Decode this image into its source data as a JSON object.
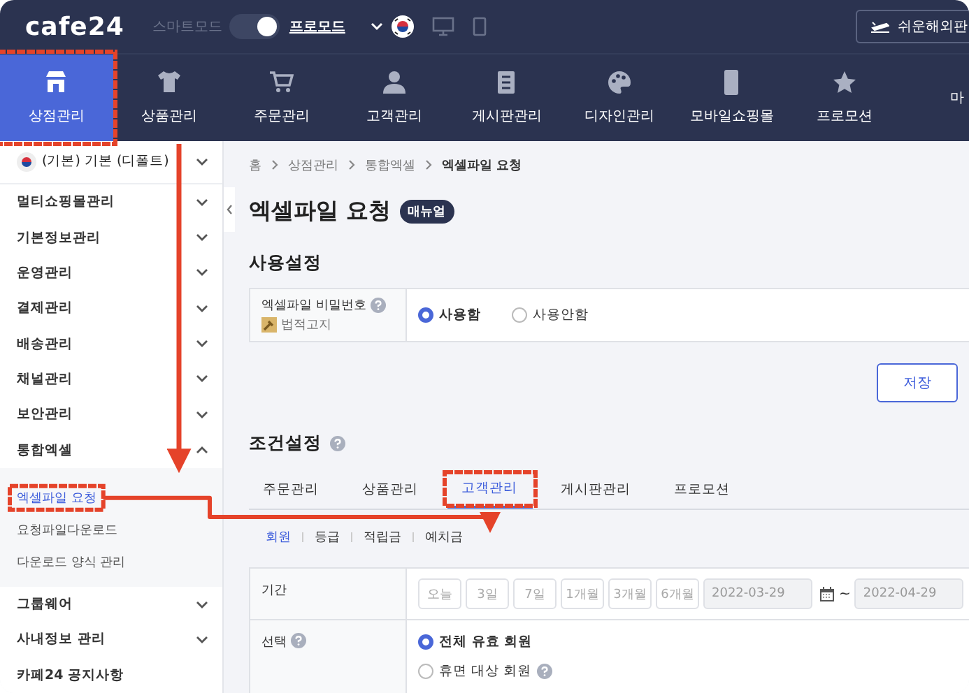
{
  "header": {
    "logo": "cafe24",
    "mode_label": "스마트모드",
    "mode_toggle": {
      "on": true
    },
    "pro_mode": "프로모드",
    "overseas_button": "쉬운해외판"
  },
  "nav": [
    {
      "label": "상점관리",
      "selected": true
    },
    {
      "label": "상품관리",
      "selected": false
    },
    {
      "label": "주문관리",
      "selected": false
    },
    {
      "label": "고객관리",
      "selected": false
    },
    {
      "label": "게시판관리",
      "selected": false
    },
    {
      "label": "디자인관리",
      "selected": false
    },
    {
      "label": "모바일쇼핑몰",
      "selected": false
    },
    {
      "label": "프로모션",
      "selected": false
    },
    {
      "label": "마",
      "selected": false
    }
  ],
  "sidebar": {
    "shop_selector": "(기본) 기본 (디폴트)",
    "items": [
      {
        "label": "멀티쇼핑몰관리",
        "kind": "group",
        "expanded": false
      },
      {
        "label": "기본정보관리",
        "kind": "group",
        "expanded": false
      },
      {
        "label": "운영관리",
        "kind": "group",
        "expanded": false
      },
      {
        "label": "결제관리",
        "kind": "group",
        "expanded": false
      },
      {
        "label": "배송관리",
        "kind": "group",
        "expanded": false
      },
      {
        "label": "채널관리",
        "kind": "group",
        "expanded": false
      },
      {
        "label": "보안관리",
        "kind": "group",
        "expanded": false
      },
      {
        "label": "통합엑셀",
        "kind": "group",
        "expanded": true,
        "children": [
          {
            "label": "엑셀파일 요청",
            "selected": true
          },
          {
            "label": "요청파일다운로드",
            "selected": false
          },
          {
            "label": "다운로드 양식 관리",
            "selected": false
          }
        ]
      },
      {
        "label": "그룹웨어",
        "kind": "group",
        "expanded": false
      },
      {
        "label": "사내정보 관리",
        "kind": "group",
        "expanded": false
      },
      {
        "label": "카페24 공지사항",
        "kind": "link",
        "expanded": false
      }
    ]
  },
  "main": {
    "breadcrumb": [
      "홈",
      "상점관리",
      "통합엑셀",
      "엑셀파일 요청"
    ],
    "title": "엑셀파일 요청",
    "manual_badge": "매뉴얼",
    "usage_section": {
      "heading": "사용설정",
      "field_label": "엑셀파일 비밀번호",
      "legal_notice": "법적고지",
      "options": [
        {
          "label": "사용함",
          "selected": true
        },
        {
          "label": "사용안함",
          "selected": false
        }
      ]
    },
    "save_button": "저장",
    "condition_section": {
      "heading": "조건설정",
      "tabs": [
        {
          "label": "주문관리",
          "selected": false
        },
        {
          "label": "상품관리",
          "selected": false
        },
        {
          "label": "고객관리",
          "selected": true
        },
        {
          "label": "게시판관리",
          "selected": false
        },
        {
          "label": "프로모션",
          "selected": false
        }
      ],
      "subtabs": [
        {
          "label": "회원",
          "selected": true
        },
        {
          "label": "등급",
          "selected": false
        },
        {
          "label": "적립금",
          "selected": false
        },
        {
          "label": "예치금",
          "selected": false
        }
      ],
      "period": {
        "label": "기간",
        "disabled": true,
        "quick": [
          "오늘",
          "3일",
          "7일",
          "1개월",
          "3개월",
          "6개월"
        ],
        "start": "2022-03-29",
        "separator": "~",
        "end": "2022-04-29"
      },
      "selection": {
        "label": "선택",
        "options": [
          {
            "label": "전체 유효 회원",
            "selected": true,
            "help": false
          },
          {
            "label": "휴면 대상 회원",
            "selected": false,
            "help": true
          }
        ]
      }
    }
  },
  "annotations": {
    "visible": true
  }
}
